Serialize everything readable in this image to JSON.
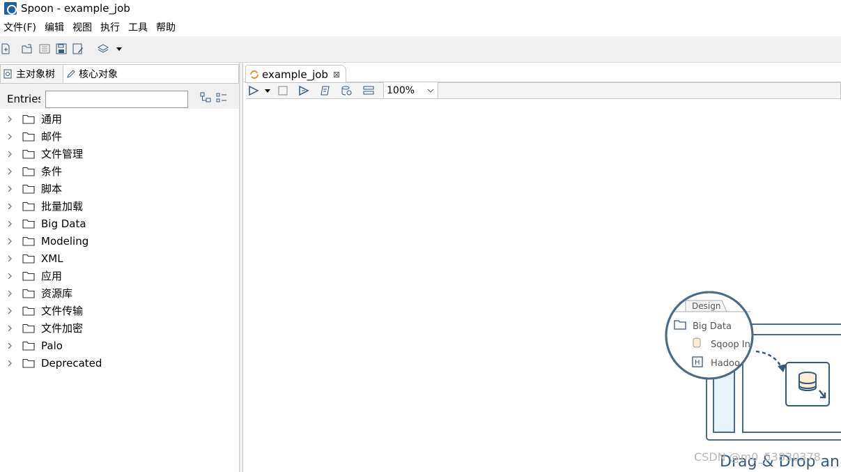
{
  "window": {
    "title": "Spoon - example_job"
  },
  "menubar": [
    "文件(F)",
    "编辑",
    "视图",
    "执行",
    "工具",
    "帮助"
  ],
  "left_panel": {
    "tabs": [
      "主对象树",
      "核心对象"
    ],
    "entries_label": "Entries",
    "entries_value": "",
    "tree": [
      "通用",
      "邮件",
      "文件管理",
      "条件",
      "脚本",
      "批量加载",
      "Big Data",
      "Modeling",
      "XML",
      "应用",
      "资源库",
      "文件传输",
      "文件加密",
      "Palo",
      "Deprecated"
    ]
  },
  "editor": {
    "tab_label": "example_job",
    "close_icon": "⊠",
    "zoom": "100%"
  },
  "hint": {
    "design_tab": "Design",
    "folder": "Big Data",
    "items": [
      "Sqoop In",
      "Hadoo"
    ],
    "caption": "Drag & Drop an E"
  },
  "watermark": "CSDN @m0_53830378",
  "colors": {
    "accent": "#35597a",
    "hint_fill": "#e9f3fa",
    "panel_bg": "#f0f0f0"
  },
  "icons": [
    "spoon-app-icon",
    "new-icon",
    "open-icon",
    "explore-icon",
    "save-icon",
    "save-as-icon",
    "layers-icon",
    "run-icon",
    "stop-icon",
    "preview-icon",
    "script-icon",
    "db-inspect-icon",
    "align-icon",
    "folder-icon",
    "chevron-right-icon"
  ]
}
